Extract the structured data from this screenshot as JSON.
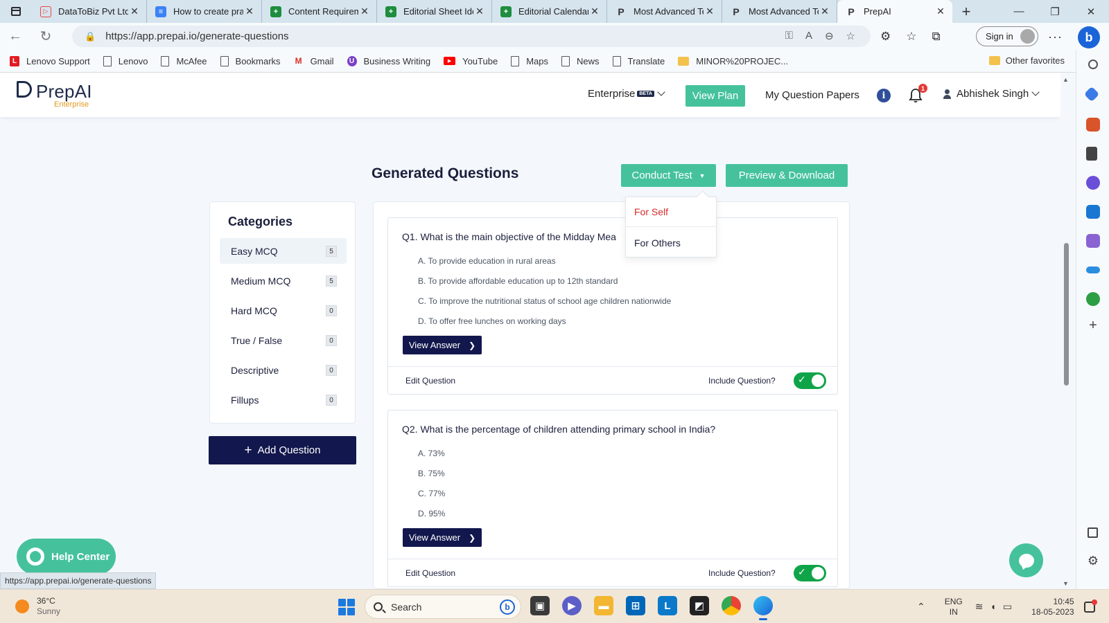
{
  "browser": {
    "tabs": [
      {
        "label": "DataToBiz Pvt Ltd",
        "icon": "datatobiz-icon",
        "color": "#e8453c"
      },
      {
        "label": "How to create pra",
        "icon": "google-docs-icon",
        "color": "#3b82f6"
      },
      {
        "label": "Content Requirem",
        "icon": "google-sheets-icon",
        "color": "#1e8e3e"
      },
      {
        "label": "Editorial Sheet Ide",
        "icon": "google-sheets-icon",
        "color": "#1e8e3e"
      },
      {
        "label": "Editorial Calendar",
        "icon": "google-sheets-icon",
        "color": "#1e8e3e"
      },
      {
        "label": "Most Advanced Te",
        "icon": "prepai-icon",
        "color": "#333333"
      },
      {
        "label": "Most Advanced Te",
        "icon": "prepai-icon",
        "color": "#333333"
      },
      {
        "label": "PrepAI",
        "icon": "prepai-icon",
        "color": "#333333",
        "active": true
      }
    ],
    "url": "https://app.prepai.io/generate-questions",
    "signin_label": "Sign in",
    "favorites": [
      {
        "label": "Lenovo Support",
        "icon": "lenovo-icon"
      },
      {
        "label": "Lenovo",
        "icon": "page-icon"
      },
      {
        "label": "McAfee",
        "icon": "page-icon"
      },
      {
        "label": "Bookmarks",
        "icon": "page-icon"
      },
      {
        "label": "Gmail",
        "icon": "gmail-icon"
      },
      {
        "label": "Business Writing",
        "icon": "business-writing-icon"
      },
      {
        "label": "YouTube",
        "icon": "youtube-icon"
      },
      {
        "label": "Maps",
        "icon": "page-icon"
      },
      {
        "label": "News",
        "icon": "page-icon"
      },
      {
        "label": "Translate",
        "icon": "page-icon"
      },
      {
        "label": "MINOR%20PROJEC...",
        "icon": "folder-icon"
      }
    ],
    "other_favorites": "Other favorites",
    "status_url": "https://app.prepai.io/generate-questions"
  },
  "header": {
    "logo_name": "PrepAI",
    "logo_sub": "Enterprise",
    "plan_label": "Enterprise",
    "beta_badge": "BETA",
    "view_plan": "View Plan",
    "my_papers": "My Question Papers",
    "notification_count": "1",
    "user_name": "Abhishek Singh"
  },
  "main": {
    "title": "Generated Questions",
    "conduct_test": "Conduct Test",
    "preview_download": "Preview & Download",
    "dropdown": {
      "for_self": "For Self",
      "for_others": "For Others"
    },
    "categories_title": "Categories",
    "categories": [
      {
        "label": "Easy MCQ",
        "count": "5",
        "selected": true
      },
      {
        "label": "Medium MCQ",
        "count": "5"
      },
      {
        "label": "Hard MCQ",
        "count": "0"
      },
      {
        "label": "True / False",
        "count": "0"
      },
      {
        "label": "Descriptive",
        "count": "0"
      },
      {
        "label": "Fillups",
        "count": "0"
      }
    ],
    "add_question": "Add Question",
    "questions": [
      {
        "text": "Q1. What is the main objective of the Midday Mea",
        "options": [
          "A. To provide education in rural areas",
          "B. To provide affordable education up to 12th standard",
          "C. To improve the nutritional status of school age children nationwide",
          "D. To offer free lunches on working days"
        ]
      },
      {
        "text": "Q2. What is the percentage of children attending primary school in India?",
        "options": [
          "A. 73%",
          "B. 75%",
          "C. 77%",
          "D. 95%"
        ]
      }
    ],
    "view_answer": "View Answer",
    "edit_question": "Edit Question",
    "include_question": "Include Question?"
  },
  "widgets": {
    "help_center": "Help Center"
  },
  "taskbar": {
    "temperature": "36°C",
    "weather": "Sunny",
    "search": "Search",
    "lang_1": "ENG",
    "lang_2": "IN",
    "time": "10:45",
    "date": "18-05-2023"
  },
  "colors": {
    "accent_green": "#45c29c",
    "navy": "#12174d",
    "toggle_on": "#10a449",
    "danger": "#d62b2b"
  }
}
